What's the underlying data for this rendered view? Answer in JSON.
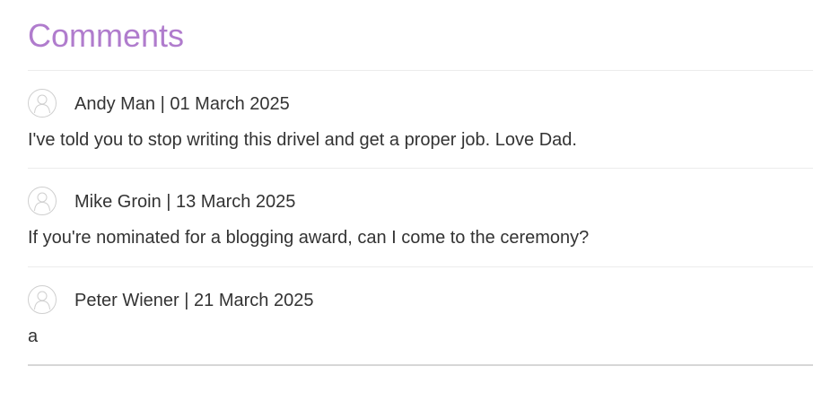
{
  "header": {
    "title": "Comments",
    "title_color": "#b07ccd"
  },
  "comments": [
    {
      "author_line": "Andy Man | 01 March 2025",
      "body": "I've told you to stop writing this drivel and get a proper job. Love Dad.",
      "avatar_icon": "user-avatar-icon"
    },
    {
      "author_line": "Mike Groin | 13 March 2025",
      "body": "If you're nominated for a blogging award, can I come to the ceremony?",
      "avatar_icon": "user-avatar-icon"
    },
    {
      "author_line": "Peter Wiener | 21 March 2025",
      "body": "a",
      "avatar_icon": "user-avatar-icon"
    }
  ]
}
